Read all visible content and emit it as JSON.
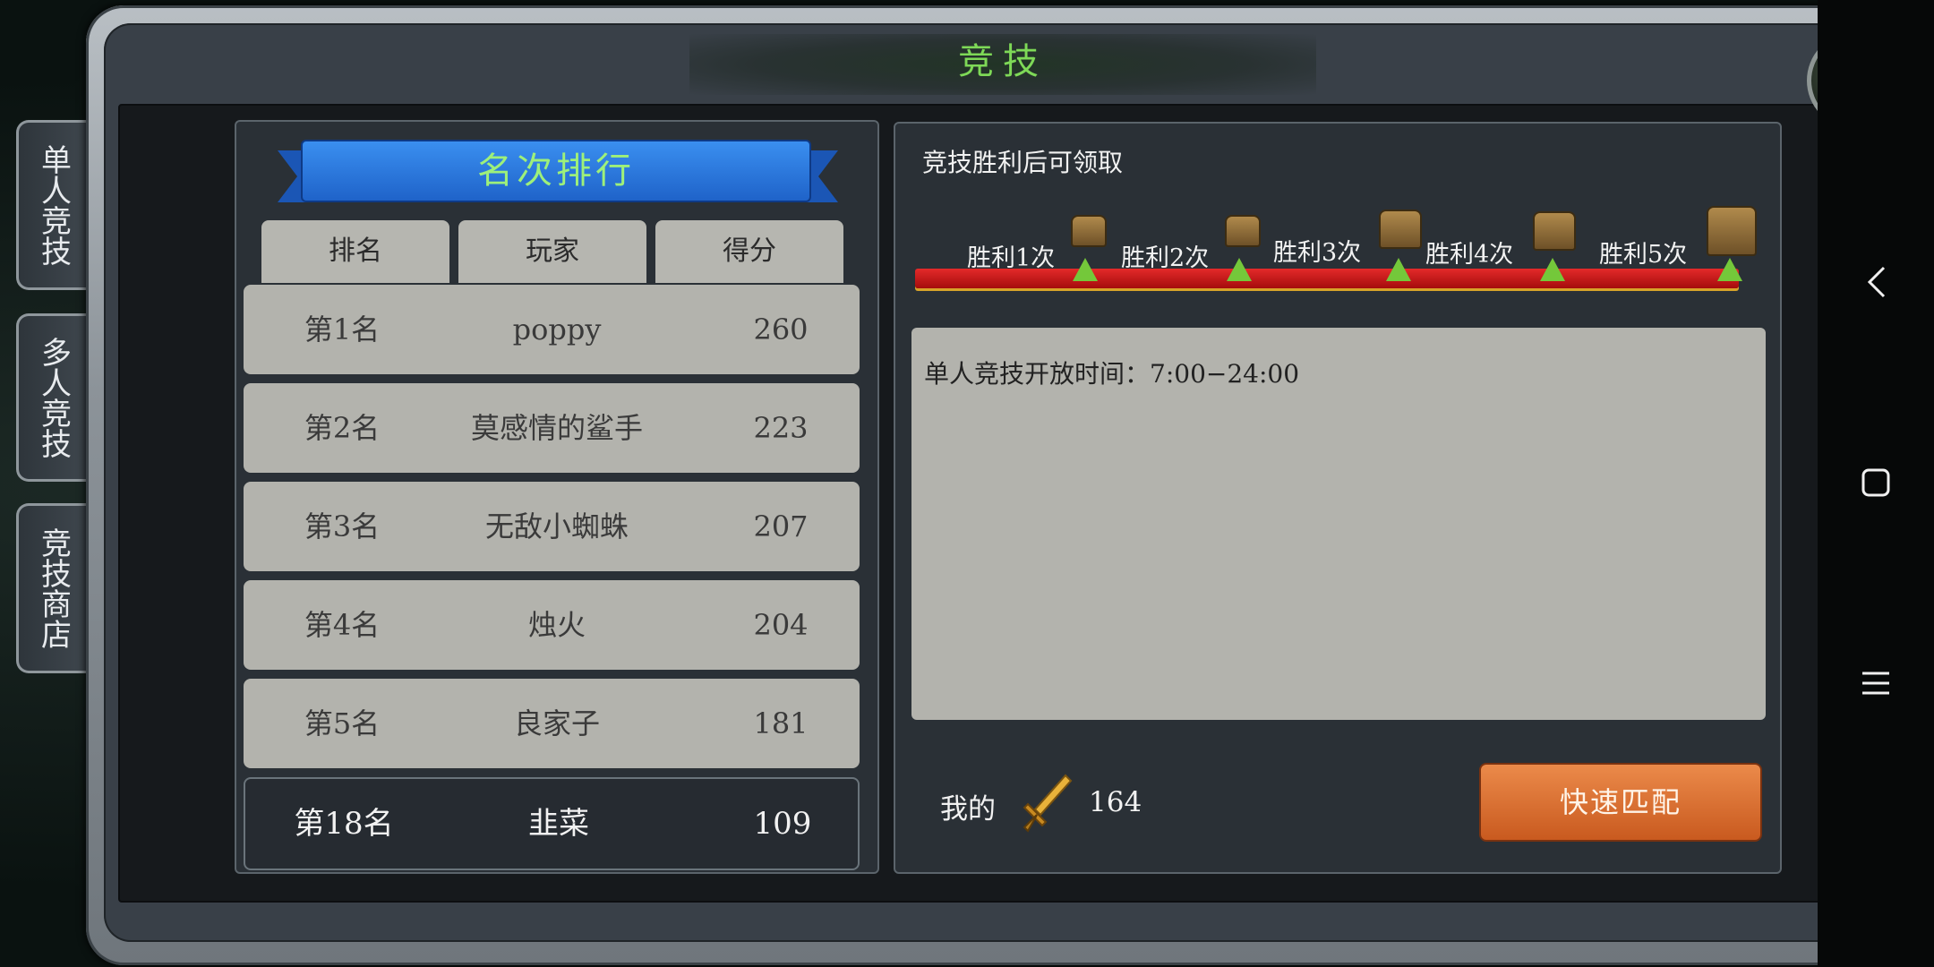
{
  "header": {
    "title": "竞技"
  },
  "side_tabs": [
    {
      "label": "单人竞技"
    },
    {
      "label": "多人竞技"
    },
    {
      "label": "竞技商店"
    }
  ],
  "ranking": {
    "banner": "名次排行",
    "columns": [
      "排名",
      "玩家",
      "得分"
    ],
    "rows": [
      {
        "rank": "第1名",
        "player": "poppy",
        "score": "260"
      },
      {
        "rank": "第2名",
        "player": "莫感情的鲨手",
        "score": "223"
      },
      {
        "rank": "第3名",
        "player": "无敌小蜘蛛",
        "score": "207"
      },
      {
        "rank": "第4名",
        "player": "烛火",
        "score": "204"
      },
      {
        "rank": "第5名",
        "player": "良家子",
        "score": "181"
      }
    ],
    "me": {
      "rank": "第18名",
      "player": "韭菜",
      "score": "109"
    }
  },
  "rewards": {
    "title": "竞技胜利后可领取",
    "milestones": [
      "胜利1次",
      "胜利2次",
      "胜利3次",
      "胜利4次",
      "胜利5次"
    ],
    "info": "单人竞技开放时间：7:00−24:00"
  },
  "footer": {
    "my_label": "我的",
    "my_score": "164",
    "match_button": "快速匹配"
  },
  "colors": {
    "accent_green": "#7ed957",
    "button_orange": "#d96a2c",
    "bar_red": "#d11c1c"
  },
  "icons": [
    "close-icon",
    "chest-icon",
    "sword-icon",
    "back-icon",
    "home-icon",
    "menu-icon"
  ]
}
